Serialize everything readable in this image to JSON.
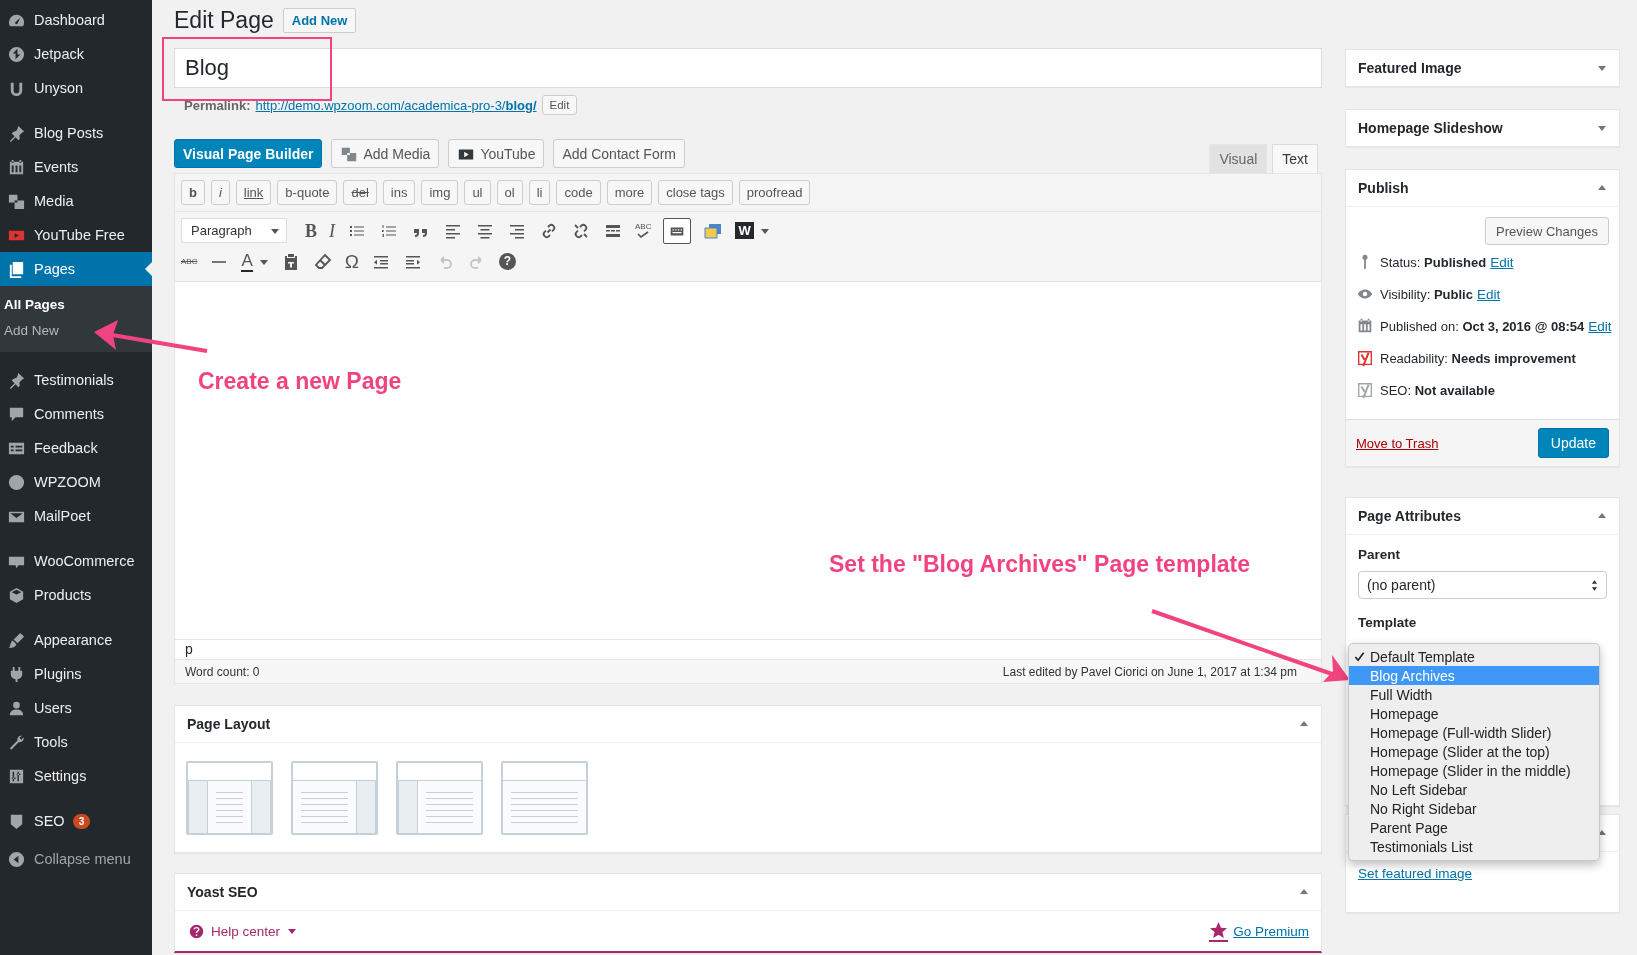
{
  "sidebar": {
    "groups": [
      {
        "items": [
          {
            "label": "Dashboard",
            "selected": false
          },
          {
            "label": "Jetpack",
            "selected": false
          },
          {
            "label": "Unyson",
            "selected": false
          }
        ]
      },
      {
        "items": [
          {
            "label": "Blog Posts",
            "selected": false
          },
          {
            "label": "Events",
            "selected": false
          },
          {
            "label": "Media",
            "selected": false
          },
          {
            "label": "YouTube Free",
            "selected": false
          },
          {
            "label": "Pages",
            "selected": true,
            "submenu": [
              {
                "label": "All Pages",
                "selected": true
              },
              {
                "label": "Add New",
                "selected": false
              }
            ]
          }
        ]
      },
      {
        "items": [
          {
            "label": "Testimonials",
            "selected": false
          },
          {
            "label": "Comments",
            "selected": false
          },
          {
            "label": "Feedback",
            "selected": false
          },
          {
            "label": "WPZOOM",
            "selected": false
          },
          {
            "label": "MailPoet",
            "selected": false
          }
        ]
      },
      {
        "items": [
          {
            "label": "WooCommerce",
            "selected": false
          },
          {
            "label": "Products",
            "selected": false
          }
        ]
      },
      {
        "items": [
          {
            "label": "Appearance",
            "selected": false
          },
          {
            "label": "Plugins",
            "selected": false
          },
          {
            "label": "Users",
            "selected": false
          },
          {
            "label": "Tools",
            "selected": false
          },
          {
            "label": "Settings",
            "selected": false
          }
        ]
      },
      {
        "items": [
          {
            "label": "SEO",
            "selected": false,
            "badge": "3"
          }
        ]
      }
    ],
    "collapse": "Collapse menu"
  },
  "header": {
    "title": "Edit Page",
    "add_new": "Add New"
  },
  "title_field": {
    "value": "Blog"
  },
  "permalink": {
    "label": "Permalink:",
    "url": "http://demo.wpzoom.com/academica-pro-3/**blog/**",
    "edit": "Edit"
  },
  "editor": {
    "media_buttons": [
      {
        "label": "Visual Page Builder",
        "kind": "primary"
      },
      {
        "label": "Add Media",
        "kind": "media"
      },
      {
        "label": "YouTube",
        "kind": "youtube"
      },
      {
        "label": "Add Contact Form",
        "kind": "plain"
      }
    ],
    "tabs": [
      {
        "label": "Visual",
        "selected": false
      },
      {
        "label": "Text",
        "selected": true
      }
    ],
    "quicktags": [
      {
        "label": "b",
        "kind": "bold"
      },
      {
        "label": "i",
        "kind": "italic"
      },
      {
        "label": "link",
        "kind": "underline"
      },
      {
        "label": "b-quote",
        "kind": "plain"
      },
      {
        "label": "del",
        "kind": "strike"
      },
      {
        "label": "ins",
        "kind": "plain"
      },
      {
        "label": "img",
        "kind": "plain"
      },
      {
        "label": "ul",
        "kind": "plain"
      },
      {
        "label": "ol",
        "kind": "plain"
      },
      {
        "label": "li",
        "kind": "plain"
      },
      {
        "label": "code",
        "kind": "plain"
      },
      {
        "label": "more",
        "kind": "plain"
      },
      {
        "label": "close tags",
        "kind": "plain"
      },
      {
        "label": "proofread",
        "kind": "plain"
      }
    ],
    "format_select": "Paragraph",
    "glyphs": {
      "bold": "B",
      "italic": "I",
      "spellcheck": "ABC",
      "word": "W",
      "strikethrough": "ABC",
      "text_color": "A",
      "special_char": "Ω",
      "help": "?"
    },
    "toolbar_toggle": {
      "pressed": true
    },
    "undo": {
      "disabled": true
    },
    "redo": {
      "disabled": true
    },
    "path": "p",
    "word_count": "Word count: 0",
    "last_edited": "Last edited by Pavel Ciorici on June 1, 2017 at 1:34 pm"
  },
  "page_layout": {
    "title": "Page Layout",
    "expanded": true,
    "options": [
      {
        "kind": "both"
      },
      {
        "kind": "right"
      },
      {
        "kind": "left"
      },
      {
        "kind": "none"
      }
    ]
  },
  "yoast": {
    "title": "Yoast SEO",
    "expanded": true,
    "help": "Help center",
    "premium": "Go Premium"
  },
  "side": {
    "featured_image": {
      "title": "Featured Image",
      "expanded": false
    },
    "slideshow": {
      "title": "Homepage Slideshow",
      "expanded": false
    },
    "publish": {
      "title": "Publish",
      "expanded": true,
      "preview": "Preview Changes",
      "rows": [
        {
          "kind": "status",
          "label": "Status:",
          "value": "Published",
          "link": "Edit"
        },
        {
          "kind": "visibility",
          "label": "Visibility:",
          "value": "Public",
          "link": "Edit"
        },
        {
          "kind": "date",
          "label": "Published on:",
          "value": "Oct 3, 2016 @ 08:54",
          "link": "Edit"
        },
        {
          "kind": "rating",
          "label": "Readability:",
          "value": "Needs improvement",
          "color": "#dc3232"
        },
        {
          "kind": "rating",
          "label": "SEO:",
          "value": "Not available",
          "color": "#a0a5aa"
        }
      ],
      "trash": "Move to Trash",
      "update": "Update"
    },
    "page_attributes": {
      "title": "Page Attributes",
      "expanded": true,
      "parent_label": "Parent",
      "parent_value": "(no parent)",
      "template_label": "Template",
      "template_options": [
        {
          "label": "Default Template",
          "checked": true,
          "selected": false
        },
        {
          "label": "Blog Archives",
          "checked": false,
          "selected": true
        },
        {
          "label": "Full Width",
          "checked": false,
          "selected": false
        },
        {
          "label": "Homepage",
          "checked": false,
          "selected": false
        },
        {
          "label": "Homepage (Full-width Slider)",
          "checked": false,
          "selected": false
        },
        {
          "label": "Homepage (Slider at the top)",
          "checked": false,
          "selected": false
        },
        {
          "label": "Homepage (Slider in the middle)",
          "checked": false,
          "selected": false
        },
        {
          "label": "No Left Sidebar",
          "checked": false,
          "selected": false
        },
        {
          "label": "No Right Sidebar",
          "checked": false,
          "selected": false
        },
        {
          "label": "Parent Page",
          "checked": false,
          "selected": false
        },
        {
          "label": "Testimonials List",
          "checked": false,
          "selected": false
        }
      ]
    },
    "lower_box": {
      "expanded": true,
      "link": "Set featured image"
    }
  },
  "annotations": [
    {
      "text": "Create a new Page"
    },
    {
      "text": "Set the \"Blog Archives\" Page template"
    }
  ]
}
